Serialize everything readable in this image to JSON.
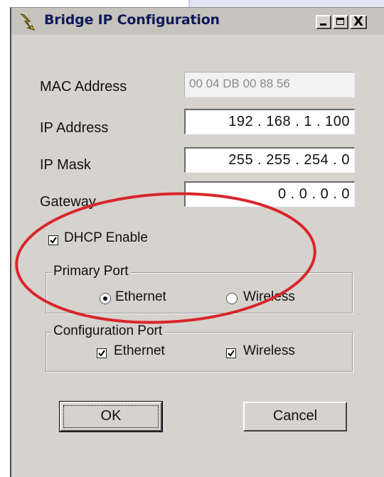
{
  "window": {
    "title": "Bridge IP Configuration",
    "controls": {
      "minimize": "_",
      "maximize": "□",
      "close": "X"
    }
  },
  "fields": {
    "mac": {
      "label": "MAC Address",
      "value": "00 04 DB 00 88 56"
    },
    "ip": {
      "label": "IP Address",
      "value": "192 . 168 .  1  . 100"
    },
    "mask": {
      "label": "IP Mask",
      "value": "255 . 255 . 254 .  0"
    },
    "gateway": {
      "label": "Gateway",
      "value": "0  .   0  .   0  .   0"
    }
  },
  "dhcp": {
    "label": "DHCP Enable",
    "checked": true
  },
  "primary_port": {
    "legend": "Primary Port",
    "selected": "Ethernet",
    "options": [
      {
        "label": "Ethernet",
        "selected": true
      },
      {
        "label": "Wireless",
        "selected": false
      }
    ]
  },
  "configuration_port": {
    "legend": "Configuration Port",
    "options": [
      {
        "label": "Ethernet",
        "checked": true
      },
      {
        "label": "Wireless",
        "checked": true
      }
    ]
  },
  "buttons": {
    "ok": "OK",
    "cancel": "Cancel"
  },
  "colors": {
    "dialog_bg": "#d6d3ce",
    "title_text": "#0f1a5a",
    "annotation_circle": "#d8262c"
  },
  "icons": {
    "app": "lightning-bolt-icon"
  }
}
